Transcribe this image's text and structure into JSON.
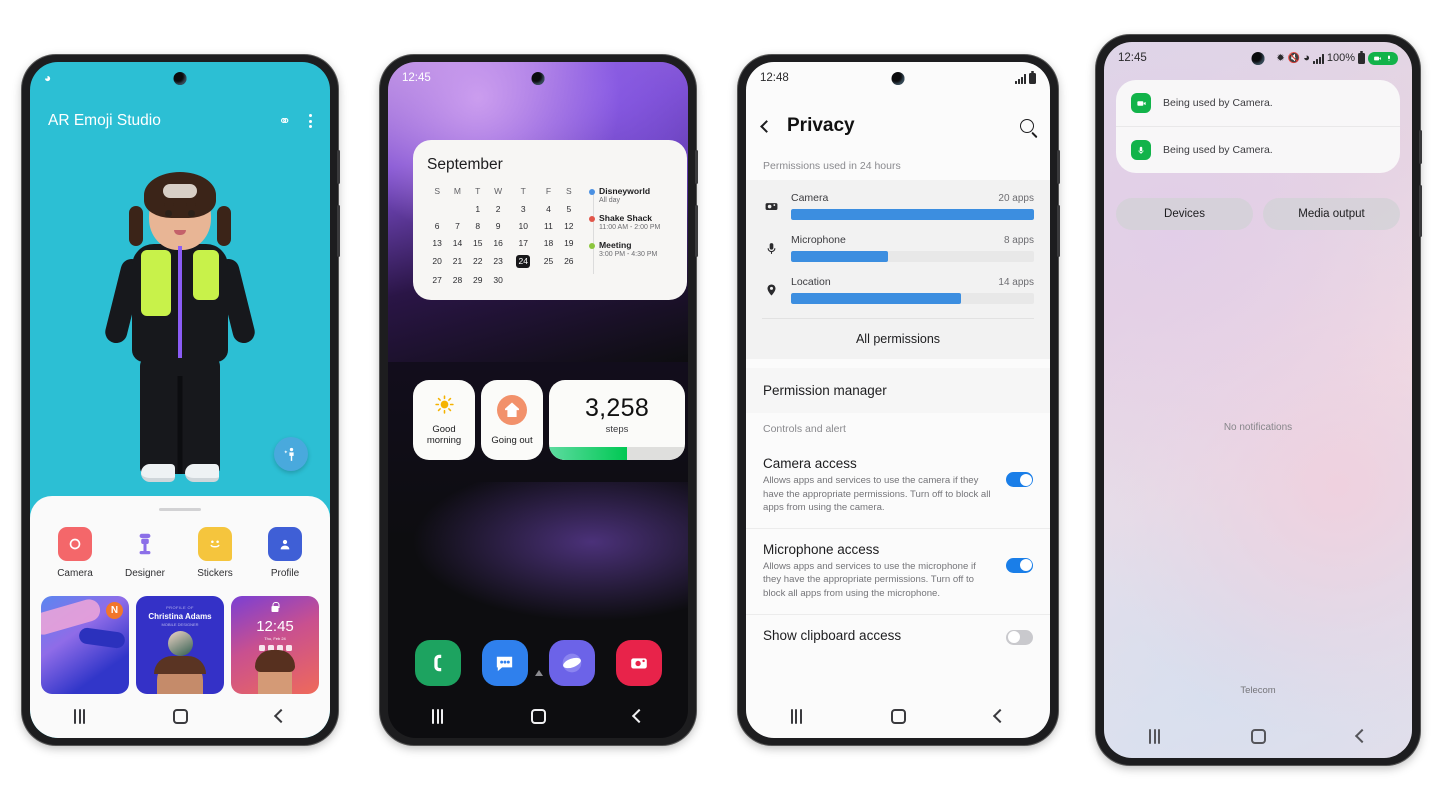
{
  "phone1": {
    "name": "ar-emoji-studio",
    "status": {
      "wifi_icon": "wifi-icon"
    },
    "header": {
      "title": "AR Emoji Studio",
      "account_icon": "account-list-icon",
      "menu_icon": "more-options-icon"
    },
    "fab": {
      "icon": "create-emoji-icon"
    },
    "bg_color": "#2CBFD4",
    "apps": [
      {
        "label": "Camera",
        "icon": "camera-icon",
        "color": "#F4676A"
      },
      {
        "label": "Designer",
        "icon": "designer-icon",
        "color": "#8C6FE8"
      },
      {
        "label": "Stickers",
        "icon": "stickers-icon",
        "color": "#F5C53D"
      },
      {
        "label": "Profile",
        "icon": "profile-icon",
        "color": "#3F5FD6"
      }
    ],
    "thumbnails": [
      {
        "name": "sticker-thumb",
        "badge": "N"
      },
      {
        "name": "profile-card-thumb",
        "kicker": "PROFILE OF",
        "title": "Christina Adams",
        "subtitle": "MOBILE DESIGNER"
      },
      {
        "name": "lockscreen-thumb",
        "time": "12:45",
        "date": "Thu, Feb 24"
      }
    ],
    "navbar": {
      "recents_icon": "recents-icon",
      "home_icon": "home-icon",
      "back_icon": "back-icon"
    }
  },
  "phone2": {
    "name": "home-screen-widgets",
    "status": {
      "time": "12:45"
    },
    "calendar": {
      "month": "September",
      "weekdays": [
        "S",
        "M",
        "T",
        "W",
        "T",
        "F",
        "S"
      ],
      "weeks": [
        [
          "",
          "",
          "1",
          "2",
          "3",
          "4",
          "5"
        ],
        [
          "6",
          "7",
          "8",
          "9",
          "10",
          "11",
          "12"
        ],
        [
          "13",
          "14",
          "15",
          "16",
          "17",
          "18",
          "19"
        ],
        [
          "20",
          "21",
          "22",
          "23",
          "24",
          "25",
          "26"
        ],
        [
          "27",
          "28",
          "29",
          "30",
          "",
          "",
          ""
        ]
      ],
      "selected_day": "24",
      "events": [
        {
          "title": "Disneyworld",
          "time": "All day",
          "color": "#4a90e2"
        },
        {
          "title": "Shake Shack",
          "time": "11:00 AM - 2:00 PM",
          "color": "#e2564a"
        },
        {
          "title": "Meeting",
          "time": "3:00 PM - 4:30 PM",
          "color": "#8cc63e"
        }
      ]
    },
    "widgets": [
      {
        "name": "routine-good-morning",
        "label": "Good\nmorning",
        "icon": "sun-icon",
        "color": "#F5B301"
      },
      {
        "name": "routine-going-out",
        "label": "Going out",
        "icon": "house-icon",
        "color": "#F2916B"
      }
    ],
    "steps_widget": {
      "value": "3,258",
      "label": "steps",
      "progress_percent": 57,
      "fill_color": "#00C853"
    },
    "page_indicator": {
      "dots": 3
    },
    "dock": [
      {
        "label": "Phone",
        "icon": "phone-icon",
        "color": "#1DA360"
      },
      {
        "label": "Messages",
        "icon": "messages-icon",
        "color": "#2F80ED"
      },
      {
        "label": "Internet",
        "icon": "internet-icon",
        "color": "#6C63E8"
      },
      {
        "label": "Camera",
        "icon": "camera-icon",
        "color": "#E8234A"
      }
    ],
    "navbar": {
      "recents_icon": "recents-icon",
      "home_icon": "home-icon",
      "back_icon": "back-icon"
    }
  },
  "phone3": {
    "name": "privacy-settings",
    "status": {
      "time": "12:48",
      "signal_icon": "signal-icon",
      "battery_icon": "battery-icon"
    },
    "header": {
      "back_icon": "back-icon",
      "title": "Privacy",
      "search_icon": "search-icon"
    },
    "permissions_section_label": "Permissions used in 24 hours",
    "permissions": [
      {
        "name": "Camera",
        "count": "20 apps",
        "icon": "camera-icon",
        "percent": 100
      },
      {
        "name": "Microphone",
        "count": "8 apps",
        "icon": "microphone-icon",
        "percent": 40
      },
      {
        "name": "Location",
        "count": "14 apps",
        "icon": "location-pin-icon",
        "percent": 70
      }
    ],
    "all_permissions_label": "All permissions",
    "permission_manager_label": "Permission manager",
    "controls_section_label": "Controls and alert",
    "toggles": [
      {
        "title": "Camera access",
        "description": "Allows apps and services to use the camera if they have the appropriate permissions. Turn off to block all apps from using the camera.",
        "state": "on"
      },
      {
        "title": "Microphone access",
        "description": "Allows apps and services to use the microphone if they have the appropriate permissions. Turn off to block all apps from using the microphone.",
        "state": "on"
      },
      {
        "title": "Show clipboard access",
        "description": "",
        "state": "off"
      }
    ],
    "accent_color": "#1A7EE8",
    "navbar": {
      "recents_icon": "recents-icon",
      "home_icon": "home-icon",
      "back_icon": "back-icon"
    }
  },
  "phone4": {
    "name": "notification-shade",
    "status": {
      "time": "12:45",
      "battery_percent": "100%",
      "icons": [
        "bluetooth-icon",
        "mute-icon",
        "wifi-icon",
        "signal-icon",
        "battery-icon"
      ],
      "indicator_icons": [
        "camera-in-use-icon",
        "microphone-in-use-icon"
      ],
      "indicator_color": "#12B34A"
    },
    "notifications": [
      {
        "text": "Being used by Camera.",
        "icon": "camera-in-use-icon"
      },
      {
        "text": "Being used by Camera.",
        "icon": "microphone-in-use-icon"
      }
    ],
    "quick_buttons": [
      {
        "label": "Devices",
        "name": "devices-button"
      },
      {
        "label": "Media output",
        "name": "media-output-button"
      }
    ],
    "empty_text": "No notifications",
    "carrier": "Telecom",
    "navbar": {
      "recents_icon": "recents-icon",
      "home_icon": "home-icon",
      "back_icon": "back-icon"
    }
  }
}
